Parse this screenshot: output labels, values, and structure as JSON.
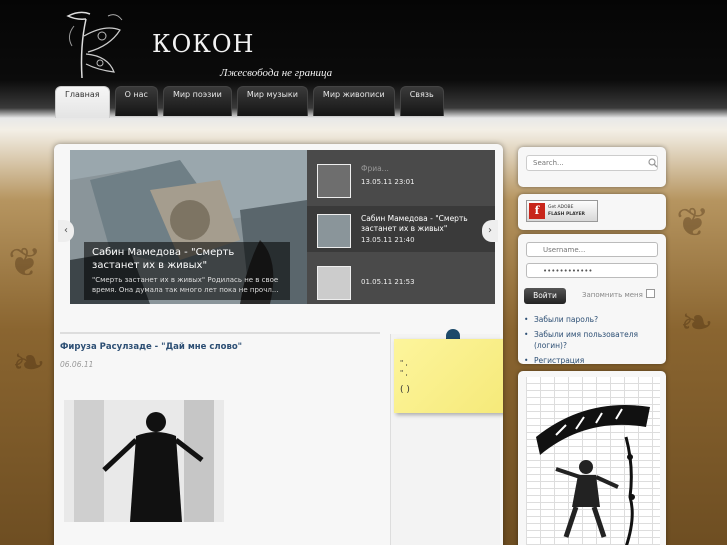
{
  "site": {
    "title": "КОКОН",
    "tagline": "Лжесвобода не граница"
  },
  "nav": {
    "tabs": [
      {
        "label": "Главная",
        "active": true
      },
      {
        "label": "О нас",
        "active": false
      },
      {
        "label": "Мир поэзии",
        "active": false
      },
      {
        "label": "Мир музыки",
        "active": false
      },
      {
        "label": "Мир живописи",
        "active": false
      },
      {
        "label": "Связь",
        "active": false
      }
    ]
  },
  "slider": {
    "main_title": "Сабин Мамедова - \"Смерть застанет их в живых\"",
    "main_desc": "\"Смерть застанет их в живых\" Родилась не в свое время. Она думала так много лет пока не прочл...",
    "prev_icon": "chevron-left-icon",
    "next_icon": "chevron-right-icon",
    "items": [
      {
        "title": "Фриа...",
        "date": "13.05.11 23:01"
      },
      {
        "title": "Сабин Мамедова - \"Смерть застанет их в живых\"",
        "date": "13.05.11 21:40"
      },
      {
        "title": "",
        "date": "01.05.11 21:53"
      }
    ]
  },
  "article": {
    "title": "Фируза Расулзаде - \"Дай мне слово\"",
    "date": "06.06.11"
  },
  "sticky": {
    "lines": [
      "\" ,",
      "\" ,",
      "( )"
    ]
  },
  "sidebar": {
    "search_placeholder": "Search...",
    "search_icon": "search-icon",
    "flash": {
      "line1": "Get ADOBE",
      "line2": "FLASH PLAYER"
    },
    "login": {
      "username_placeholder": "Username...",
      "password_value": "••••••••••••",
      "submit_label": "Войти",
      "remember_label": "Запомнить меня",
      "links": [
        "Забыли пароль?",
        "Забыли имя пользователя (логин)?",
        "Регистрация"
      ]
    }
  },
  "colors": {
    "link": "#2d4f74",
    "header": "#050505",
    "sticky": "#fdf59c"
  }
}
